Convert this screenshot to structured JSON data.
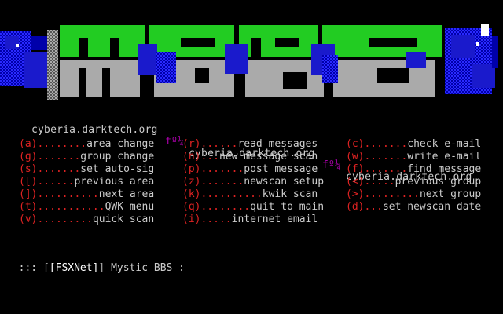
{
  "banner": {
    "label": "MSDS logo banner",
    "colors": {
      "green": "#22cc22",
      "grey": "#aaaaaa",
      "blue": "#1a1acc",
      "dark_blue": "#0000aa",
      "white": "#ffffff"
    }
  },
  "host_line": {
    "urls": [
      "cyberia.darktech.org",
      "cyberia.darktech.org",
      "cyberia.darktech.org"
    ],
    "separators": [
      "fº¼",
      "fº¼"
    ]
  },
  "menu": {
    "col1": [
      {
        "key": "(a)",
        "dots": "........",
        "label": "area change"
      },
      {
        "key": "(g)",
        "dots": ".......",
        "label": "group change"
      },
      {
        "key": "(s)",
        "dots": ".......",
        "label": "set auto-sig"
      },
      {
        "key": "([)",
        "dots": "......",
        "label": "previous area"
      },
      {
        "key": "(])",
        "dots": "..........",
        "label": "next area"
      },
      {
        "key": "(t)",
        "dots": "...........",
        "label": "QWK menu"
      },
      {
        "key": "(v)",
        "dots": ".........",
        "label": "quick scan"
      }
    ],
    "col2": [
      {
        "key": "(r)",
        "dots": "......",
        "label": "read messages"
      },
      {
        "key": "(n)",
        "dots": "...",
        "label": "new message scan"
      },
      {
        "key": "(p)",
        "dots": ".......",
        "label": "post message"
      },
      {
        "key": "(z)",
        "dots": ".......",
        "label": "newscan setup"
      },
      {
        "key": "(k)",
        "dots": "..........",
        "label": "kwik scan"
      },
      {
        "key": "(q)",
        "dots": "........",
        "label": "quit to main"
      },
      {
        "key": "(i)",
        "dots": ".....",
        "label": "internet email"
      }
    ],
    "col3": [
      {
        "key": "(c)",
        "dots": ".......",
        "label": "check e-mail"
      },
      {
        "key": "(w)",
        "dots": ".......",
        "label": "write e-mail"
      },
      {
        "key": "(f)",
        "dots": ".......",
        "label": "find message"
      },
      {
        "key": "(<)",
        "dots": ".....",
        "label": "previous group"
      },
      {
        "key": "(>)",
        "dots": ".........",
        "label": "next group"
      },
      {
        "key": "(d)",
        "dots": "...",
        "label": "set newscan date"
      }
    ]
  },
  "prompt": {
    "prefix": "::: ",
    "bracket_open": "[",
    "net": "[FSXNet]",
    "bracket_close": "]",
    "suffix": " Mystic BBS :"
  }
}
